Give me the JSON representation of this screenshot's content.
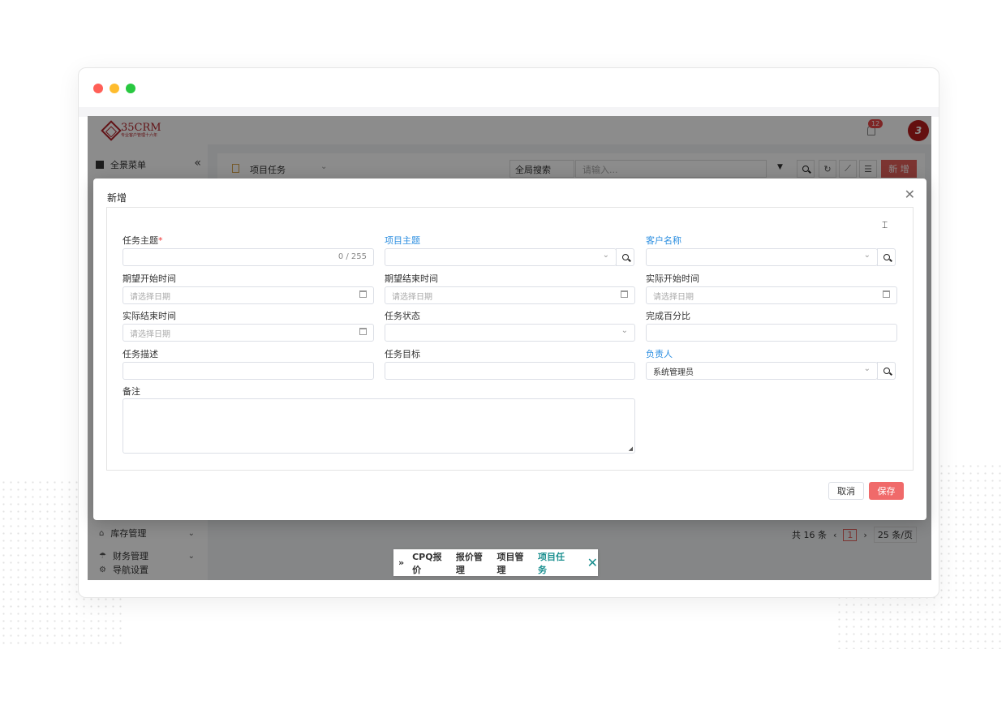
{
  "header": {
    "logo_name": "35CRM",
    "logo_sub": "专业客户管理十六年",
    "notification_count": "12",
    "avatar_text": "3"
  },
  "sidebar": {
    "title": "全景菜单",
    "collapse": "«",
    "items": [
      {
        "label": "库存管理"
      },
      {
        "label": "财务管理"
      },
      {
        "label": "导航设置"
      }
    ]
  },
  "toolbar": {
    "module": "项目任务",
    "search_scope": "全局搜索",
    "search_placeholder": "请输入...",
    "new_label": "新 增"
  },
  "pager": {
    "total": "共 16 条",
    "current_page": "1",
    "page_size": "25 条/页"
  },
  "bottom_tabs": {
    "items": [
      "CPQ报价",
      "报价管理",
      "项目管理",
      "项目任务"
    ],
    "active": "项目任务"
  },
  "modal": {
    "title": "新增",
    "fields": {
      "task_subject": {
        "label": "任务主题",
        "counter": "0 / 255"
      },
      "project_subject": {
        "label": "项目主题"
      },
      "customer_name": {
        "label": "客户名称"
      },
      "expected_start": {
        "label": "期望开始时间",
        "placeholder": "请选择日期"
      },
      "expected_end": {
        "label": "期望结束时间",
        "placeholder": "请选择日期"
      },
      "actual_start": {
        "label": "实际开始时间",
        "placeholder": "请选择日期"
      },
      "actual_end": {
        "label": "实际结束时间",
        "placeholder": "请选择日期"
      },
      "task_status": {
        "label": "任务状态"
      },
      "completion_pct": {
        "label": "完成百分比"
      },
      "task_desc": {
        "label": "任务描述"
      },
      "task_goal": {
        "label": "任务目标"
      },
      "owner": {
        "label": "负责人",
        "value": "系统管理员"
      },
      "remark": {
        "label": "备注"
      }
    },
    "cancel_label": "取消",
    "save_label": "保存"
  },
  "colors": {
    "accent_red": "#e25f5a",
    "link_blue": "#2b8ee0",
    "teal": "#1a8f8f"
  }
}
